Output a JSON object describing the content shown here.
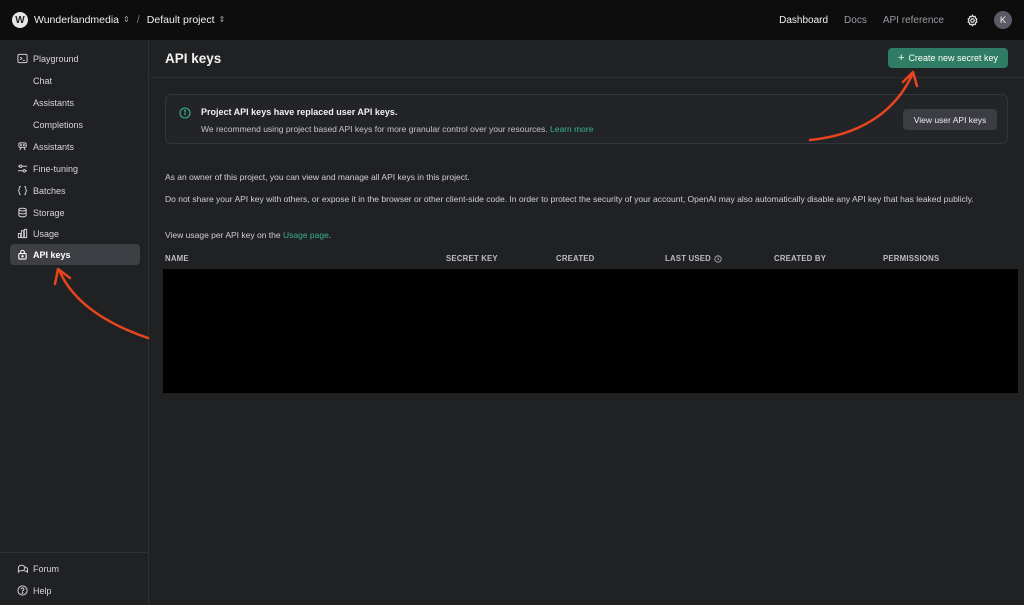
{
  "topbar": {
    "org_initial": "W",
    "org_name": "Wunderlandmedia",
    "separator": "/",
    "project_name": "Default project",
    "nav": [
      "Dashboard",
      "Docs",
      "API reference"
    ],
    "user_initial": "K"
  },
  "sidebar": {
    "items": [
      {
        "label": "Playground",
        "icon": "terminal-icon"
      },
      {
        "label": "Chat",
        "icon": ""
      },
      {
        "label": "Assistants",
        "icon": ""
      },
      {
        "label": "Completions",
        "icon": ""
      },
      {
        "label": "Assistants",
        "icon": "robot-icon"
      },
      {
        "label": "Fine-tuning",
        "icon": "sliders-icon"
      },
      {
        "label": "Batches",
        "icon": "braces-icon"
      },
      {
        "label": "Storage",
        "icon": "database-icon"
      },
      {
        "label": "Usage",
        "icon": "bar-chart-icon"
      },
      {
        "label": "API keys",
        "icon": "lock-icon"
      }
    ],
    "footer": [
      {
        "label": "Forum",
        "icon": "chat-bubbles-icon"
      },
      {
        "label": "Help",
        "icon": "help-icon"
      }
    ]
  },
  "main": {
    "title": "API keys",
    "create_button": "Create new secret key",
    "create_button_plus": "+",
    "info": {
      "title": "Project API keys have replaced user API keys.",
      "text": "We recommend using project based API keys for more granular control over your resources.",
      "link": "Learn more",
      "button": "View user API keys"
    },
    "paragraphs": {
      "p1": "As an owner of this project, you can view and manage all API keys in this project.",
      "p2": "Do not share your API key with others, or expose it in the browser or other client-side code. In order to protect the security of your account, OpenAI may also automatically disable any API key that has leaked publicly.",
      "p3_prefix": "View usage per API key on the ",
      "p3_link": "Usage page",
      "p3_suffix": "."
    },
    "table": {
      "headers": [
        "NAME",
        "SECRET KEY",
        "CREATED",
        "LAST USED",
        "CREATED BY",
        "PERMISSIONS"
      ]
    }
  },
  "colors": {
    "accent": "#2f7d64",
    "link": "#36b38a",
    "annotation_arrow": "#e8451e"
  }
}
